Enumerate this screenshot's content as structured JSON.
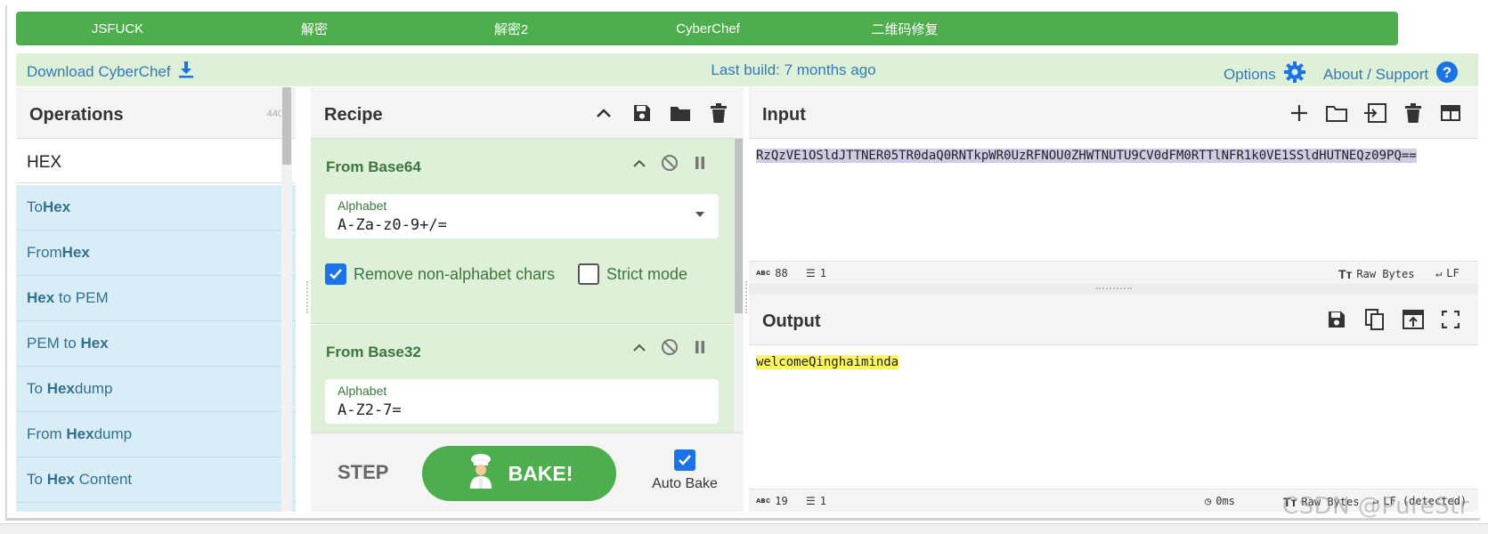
{
  "top_buttons": [
    "JSFUCK",
    "解密",
    "解密2",
    "CyberChef",
    "二维码修复",
    "",
    ""
  ],
  "banner": {
    "download": "Download CyberChef",
    "build": "Last build: 7 months ago",
    "options": "Options",
    "about": "About / Support"
  },
  "operations": {
    "title": "Operations",
    "count": "440",
    "search_value": "HEX",
    "items": [
      {
        "pre": "To ",
        "match": "Hex",
        "post": ""
      },
      {
        "pre": "From ",
        "match": "Hex",
        "post": ""
      },
      {
        "pre": "",
        "match": "Hex",
        "post": " to PEM"
      },
      {
        "pre": "PEM to ",
        "match": "Hex",
        "post": ""
      },
      {
        "pre": "To ",
        "match": "Hex",
        "post": "dump"
      },
      {
        "pre": "From ",
        "match": "Hex",
        "post": "dump"
      },
      {
        "pre": "To ",
        "match": "Hex",
        "post": " Content"
      }
    ]
  },
  "recipe": {
    "title": "Recipe",
    "op1": {
      "name": "From Base64",
      "arg_label": "Alphabet",
      "arg_value": "A-Za-z0-9+/=",
      "remove_label": "Remove non-alphabet chars",
      "strict_label": "Strict mode"
    },
    "op2": {
      "name": "From Base32",
      "arg_label": "Alphabet",
      "arg_value": "A-Z2-7="
    },
    "step": "STEP",
    "bake": "BAKE!",
    "auto_bake": "Auto Bake"
  },
  "input": {
    "title": "Input",
    "text": "RzQzVE1OSldJTTNER05TR0daQ0RNTkpWR0UzRFNOU0ZHWTNUTU9CV0dFM0RTTlNFR1k0VE1SSldHUTNEQz09PQ==",
    "chars": "88",
    "lines": "1",
    "raw": "Raw Bytes",
    "eol": "LF"
  },
  "output": {
    "title": "Output",
    "text": "welcomeQinghaiminda",
    "chars": "19",
    "lines": "1",
    "time": "0ms",
    "raw": "Raw Bytes",
    "eol": "LF (detected)"
  },
  "watermark": "CSDN @PureStr",
  "colors": {
    "green": "#4cae4c",
    "banner": "#dff0d8",
    "link": "#337ab7",
    "ops_bg": "#d9edf7",
    "card_bg": "#dff0d8",
    "select": "#cfcde6",
    "highlight": "#fcf75e"
  }
}
